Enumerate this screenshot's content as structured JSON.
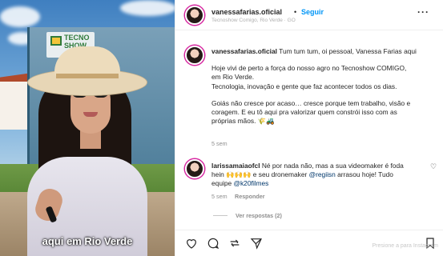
{
  "media": {
    "sign_text": "TECNO SHOW",
    "caption": "aqui em Rio Verde"
  },
  "header": {
    "username": "vanessafarias.oficial",
    "separator": "•",
    "follow_label": "Seguir",
    "subtitle": "Tecnoshow Comigo, Rio Verde · GO",
    "more_label": "···"
  },
  "post": {
    "username": "vanessafarias.oficial",
    "lines_1": "Tum tum tum, oi pessoal, Vanessa Farias aqui",
    "p2_l1": "Hoje vivi de perto a força do nosso agro no Tecnoshow COMIGO,",
    "p2_l2": "em Rio Verde.",
    "p2_l3": "Tecnologia, inovação e gente que faz acontecer todos os dias.",
    "p3_l1": "Goiás não cresce por acaso… cresce porque tem trabalho, visão e",
    "p3_l2": "coragem. E eu tô aqui pra valorizar quem constrói isso com as",
    "p3_l3": "próprias mãos. 🌾🚜",
    "time": "5 sem"
  },
  "comment": {
    "username": "larissamaiaofcl",
    "text_1": " Né por nada não, mas a sua videomaker é foda",
    "text_2a": "hein 🙌🙌🙌 e seu dronemaker ",
    "mention_1": "@regiisn",
    "text_2b": " arrasou hoje! Tudo",
    "text_3a": "equipe ",
    "mention_2": "@k20filmes",
    "time": "5 sem",
    "reply_label": "Responder",
    "view_replies": "Ver respostas (2)",
    "like_icon": "heart-icon"
  },
  "actions": {
    "overlay_text": "Presione a para Instagram"
  }
}
